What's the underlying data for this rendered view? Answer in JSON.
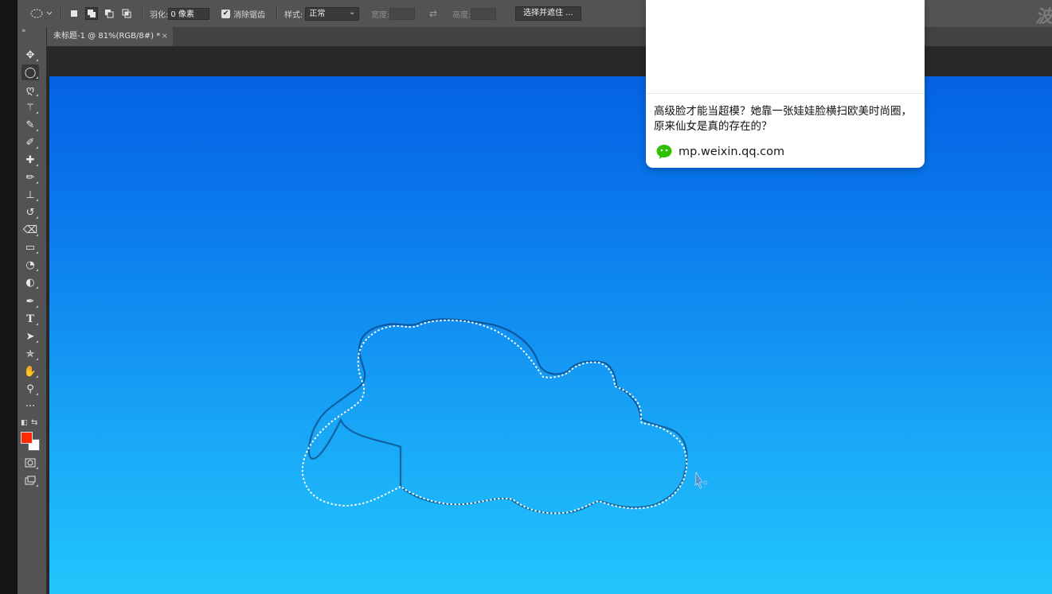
{
  "options_bar": {
    "tool_icon": "elliptical-marquee-icon",
    "feather_label": "羽化:",
    "feather_value": "0 像素",
    "antialias_checked": true,
    "antialias_label": "消除锯齿",
    "style_label": "样式:",
    "style_value": "正常",
    "width_label": "宽度:",
    "height_label": "高度:",
    "swap_icon": "swap-arrows-icon",
    "select_mask_button": "选择并遮住 ...",
    "corner_text": "波"
  },
  "document_tab": {
    "title": "未标题-1 @ 81%(RGB/8#) *",
    "close": "×"
  },
  "toolbox": {
    "collapse": "»",
    "tools": [
      {
        "name": "move-tool",
        "glyph": "✥"
      },
      {
        "name": "elliptical-marquee-tool",
        "glyph": "◯"
      },
      {
        "name": "lasso-tool",
        "glyph": "ღ"
      },
      {
        "name": "magic-wand-tool",
        "glyph": "⚚"
      },
      {
        "name": "quick-selection-tool",
        "glyph": "✎"
      },
      {
        "name": "eyedropper-tool",
        "glyph": "✐"
      },
      {
        "name": "healing-brush-tool",
        "glyph": "✚"
      },
      {
        "name": "brush-tool",
        "glyph": "✏"
      },
      {
        "name": "clone-stamp-tool",
        "glyph": "⊥"
      },
      {
        "name": "history-brush-tool",
        "glyph": "↺"
      },
      {
        "name": "eraser-tool",
        "glyph": "⌫"
      },
      {
        "name": "gradient-tool",
        "glyph": "▭"
      },
      {
        "name": "blur-tool",
        "glyph": "◔"
      },
      {
        "name": "dodge-tool",
        "glyph": "◐"
      },
      {
        "name": "pen-tool",
        "glyph": "✒"
      },
      {
        "name": "type-tool",
        "glyph": "T"
      },
      {
        "name": "path-selection-tool",
        "glyph": "➤"
      },
      {
        "name": "custom-shape-tool",
        "glyph": "✯"
      },
      {
        "name": "hand-tool",
        "glyph": "✋"
      },
      {
        "name": "zoom-tool",
        "glyph": "⚲"
      },
      {
        "name": "edit-toolbar",
        "glyph": "···"
      }
    ],
    "foreground_color": "#ff2a00",
    "background_color": "#ffffff"
  },
  "canvas": {
    "gradient_top": "#0462e4",
    "gradient_bottom": "#22c6fd"
  },
  "popup": {
    "title": "高级脸才能当超模？她靠一张娃娃脸横扫欧美时尚圈，原来仙女是真的存在的？",
    "icon": "wechat-icon",
    "domain": "mp.weixin.qq.com"
  }
}
